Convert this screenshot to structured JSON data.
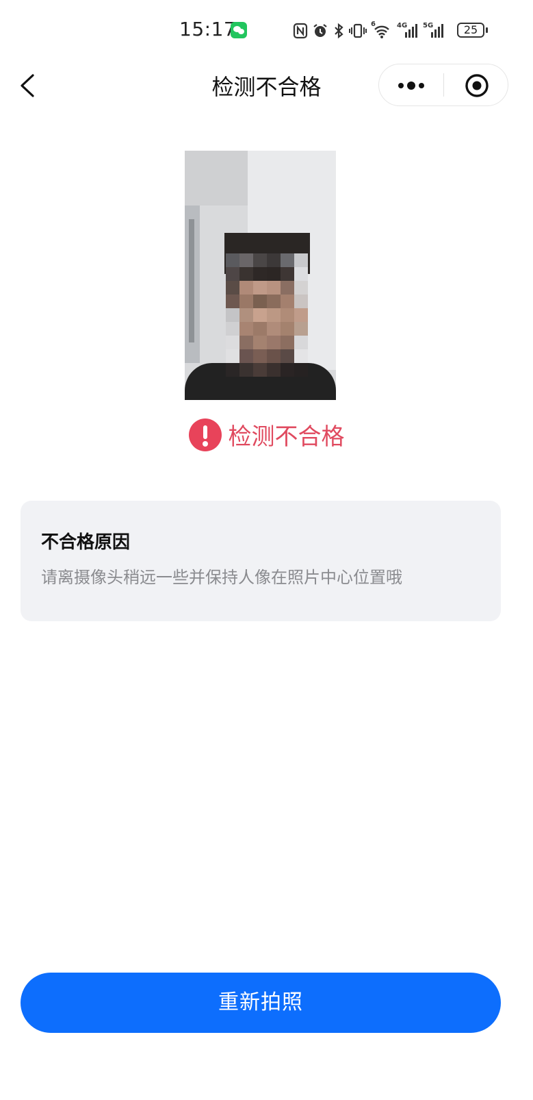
{
  "status_bar": {
    "time": "15:17",
    "battery": "25",
    "icons": [
      "wechat-icon",
      "nfc-icon",
      "alarm-icon",
      "bluetooth-icon",
      "vibrate-icon",
      "wifi-icon",
      "signal-4g-icon",
      "signal-5g-icon",
      "battery-icon"
    ],
    "net_labels": {
      "wifi": "6",
      "sim1": "4G",
      "sim2": "5G"
    }
  },
  "nav": {
    "title": "检测不合格",
    "back_icon": "chevron-left-icon",
    "more_icon": "more-dots-icon",
    "close_icon": "target-circle-icon"
  },
  "result": {
    "status_text": "检测不合格",
    "icon": "exclamation-circle-icon",
    "color": "#e04a5f"
  },
  "reason_card": {
    "title": "不合格原因",
    "message": "请离摄像头稍远一些并保持人像在照片中心位置哦"
  },
  "actions": {
    "retake_label": "重新拍照",
    "accent": "#0d6efd"
  }
}
